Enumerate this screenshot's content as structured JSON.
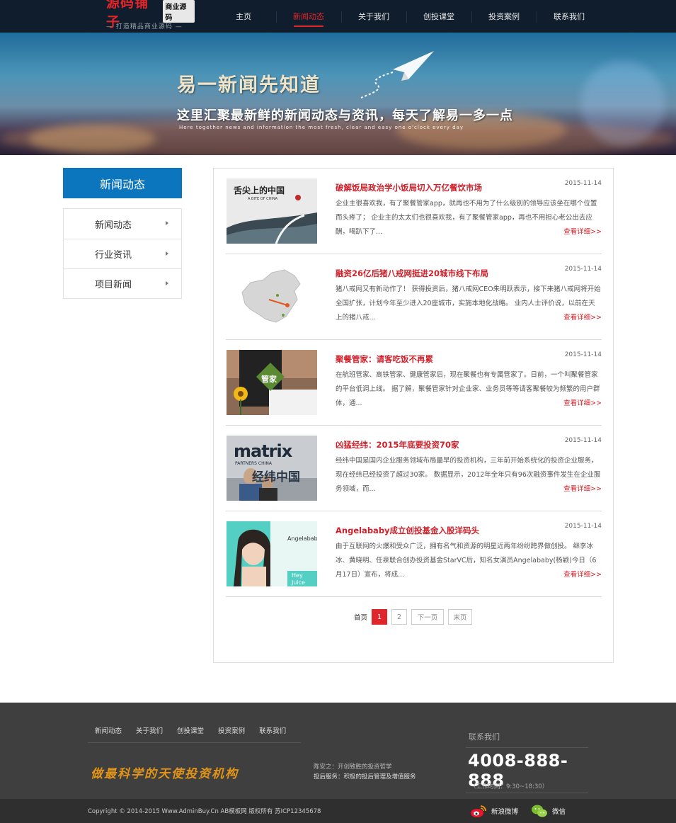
{
  "header": {
    "logo_main": "源码铺子",
    "logo_badge": "商业源码",
    "logo_tagline": "— 打造精品商业源码 —",
    "nav": [
      "主页",
      "新闻动态",
      "关于我们",
      "创投课堂",
      "投资案例",
      "联系我们"
    ],
    "active_nav": "新闻动态"
  },
  "banner": {
    "title": "易一新闻先知道",
    "subtitle": "这里汇聚最新鲜的新闻动态与资讯，每天了解易一多一点",
    "subtitle_en": "Here together news and information the most fresh, clear and easy one o'clock every day"
  },
  "sidebar": {
    "title": "新闻动态",
    "items": [
      {
        "label": "新闻动态"
      },
      {
        "label": "行业资讯"
      },
      {
        "label": "项目新闻"
      }
    ]
  },
  "articles": [
    {
      "title": "破解饭局政治学小饭局切入万亿餐饮市场",
      "date": "2015-11-14",
      "summary": "企业主很喜欢我，有了聚餐管家app，就再也不用为了什么级别的领导应该坐在哪个位置而头疼了； 企业主的太太们也很喜欢我，有了聚餐管家app，再也不用担心老公出去应酬，喝趴下了...",
      "more": "查看详细>>",
      "thumb_text": "舌尖上的中国",
      "thumb_sub": "A BITE OF CHINA"
    },
    {
      "title": "融资26亿后猪八戒网挺进20城市线下布局",
      "date": "2015-11-14",
      "summary": "猪八戒网又有新动作了！ 获得投资后，猪八戒网CEO朱明跃表示，接下来猪八戒网将开始全国扩张，计划今年至少进入20座城市，实施本地化战略。 业内人士评价说，以前在天上的猪八戒...",
      "more": "查看详细>>"
    },
    {
      "title": "聚餐管家：请客吃饭不再累",
      "date": "2015-11-14",
      "summary": "在航班管家、高铁管家、健康管家后，现在聚餐也有专属管家了。日前，一个叫聚餐管家的平台低调上线。 据了解，聚餐管家针对企业家、业务员等等请客聚餐较为频繁的用户群体，通...",
      "more": "查看详细>>",
      "thumb_text": "管家"
    },
    {
      "title": "凶猛经纬：2015年底要投资70家",
      "date": "2015-11-14",
      "summary": "经纬中国是国内企业服务领域布局最早的投资机构，三年前开始系统化的投资企业服务，现在经纬已经投资了超过30家。 数据显示，2012年全年只有96次融资事件发生在企业服务领域，而...",
      "more": "查看详细>>",
      "thumb_text": "matrix",
      "thumb_sub": "PARTNERS CHINA",
      "thumb_cn": "经纬中国"
    },
    {
      "title": "Angelababy成立创投基金入股洋码头",
      "date": "2015-11-14",
      "summary": "由于互联网的火爆和受众广泛，拥有名气和资源的明星近两年纷纷跨界做创投。 继李冰冰、黄晓明、任泉联合创办投资基金StarVC后，知名女演员Angelababy(杨颖)今日（6月17日）宣布，将成...",
      "more": "查看详细>>",
      "thumb_text": "Angelababy",
      "thumb_sub": "Hey Juice"
    }
  ],
  "pagination": {
    "first": "首页",
    "pages": [
      "1",
      "2"
    ],
    "current": "1",
    "next": "下一页",
    "last": "末页"
  },
  "footer": {
    "nav": [
      "新闻动态",
      "关于我们",
      "创投课堂",
      "投资案例",
      "联系我们"
    ],
    "slogan": "做最科学的天使投资机构",
    "note_line1": "陈安之：开创致胜的投资哲学",
    "note_line2": "投后服务：积极的投后管理及增值服务",
    "contact_title": "联系我们",
    "phone": "4008-888-888",
    "hours": "（工作时间：9:30~18:30）",
    "copyright": "Copyright © 2014-2015 Www.AdminBuy.Cn AB模板网 版权所有 苏ICP12345678",
    "weibo": "新浪微博",
    "wechat": "微信"
  },
  "colors": {
    "accent_red": "#e0262b",
    "sidebar_blue": "#0b75bd",
    "header_bg": "#0f1d2c",
    "footer_bg": "#3f3f3f",
    "slogan_orange": "#e29418"
  }
}
